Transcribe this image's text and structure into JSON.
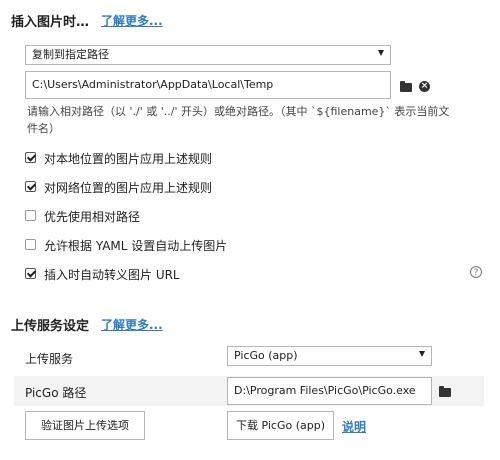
{
  "insert_image": {
    "title": "插入图片时…",
    "learn_more": "了解更多...",
    "action_select": "复制到指定路径",
    "path_value": "C:\\Users\\Administrator\\AppData\\Local\\Temp",
    "hint": "请输入相对路径（以 './' 或 '../' 开头）或绝对路径。（其中 `${filename}` 表示当前文件名）",
    "hint_line1": "请输入相对路径（以 './' 或 '../' 开头）或绝对路径。（其中 `${filename}` 表示当前文",
    "hint_line2": "件名）",
    "options": [
      {
        "label": "对本地位置的图片应用上述规则",
        "checked": true
      },
      {
        "label": "对网络位置的图片应用上述规则",
        "checked": true
      },
      {
        "label": "优先使用相对路径",
        "checked": false
      },
      {
        "label": "允许根据 YAML 设置自动上传图片",
        "checked": false
      },
      {
        "label": "插入时自动转义图片 URL",
        "checked": true
      }
    ],
    "help_glyph": "?"
  },
  "upload": {
    "title": "上传服务设定",
    "learn_more": "了解更多...",
    "service_label": "上传服务",
    "service_value": "PicGo (app)",
    "path_label": "PicGo 路径",
    "path_value": "D:\\Program Files\\PicGo\\PicGo.exe",
    "verify_button": "验证图片上传选项",
    "download_button": "下载 PicGo (app)",
    "help_link": "说明"
  },
  "icons": {
    "folder": "folder-icon",
    "clear": "clear-icon",
    "help": "help-icon",
    "chevron": "chevron-down-icon"
  }
}
